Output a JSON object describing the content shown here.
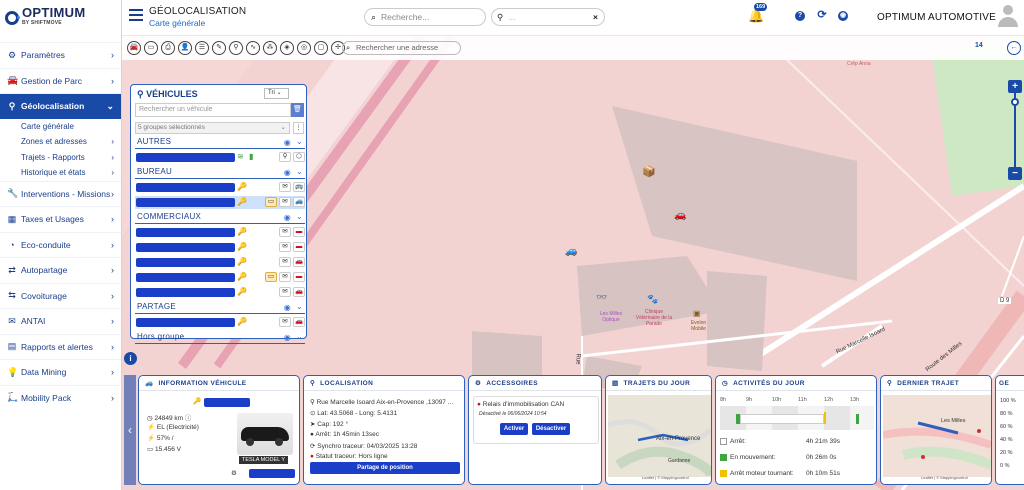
{
  "brand": {
    "name": "OPTIMUM",
    "tagline": "BY SHIFTMOVE"
  },
  "sidebar": {
    "items": [
      {
        "label": "Paramètres",
        "icon": "gear-icon"
      },
      {
        "label": "Gestion de Parc",
        "icon": "car-icon"
      },
      {
        "label": "Géolocalisation",
        "icon": "map-pin-icon",
        "active": true,
        "sub": [
          "Carte générale",
          "Zones et adresses",
          "Trajets - Rapports",
          "Historique et états"
        ]
      },
      {
        "label": "Interventions - Missions",
        "icon": "wrench-icon"
      },
      {
        "label": "Taxes et Usages",
        "icon": "money-icon"
      },
      {
        "label": "Eco-conduite",
        "icon": "eco-icon"
      },
      {
        "label": "Autopartage",
        "icon": "share-icon"
      },
      {
        "label": "Covoiturage",
        "icon": "carpool-icon"
      },
      {
        "label": "ANTAI",
        "icon": "mail-icon"
      },
      {
        "label": "Rapports et alertes",
        "icon": "report-icon"
      },
      {
        "label": "Data Mining",
        "icon": "bulb-icon"
      },
      {
        "label": "Mobility Pack",
        "icon": "scooter-icon"
      }
    ]
  },
  "header": {
    "title": "GÉOLOCALISATION",
    "subtitle": "Carte générale",
    "search_placeholder": "Recherche...",
    "location_placeholder": "...",
    "notif_count": "169",
    "company": "OPTIMUM AUTOMOTIVE"
  },
  "toolbar": {
    "address_placeholder": "Rechercher une adresse",
    "zoom_level": "14"
  },
  "map": {
    "labels": {
      "pharmacy": "Les Milles Optique",
      "clinic": "Clinique Vétérinaire de la Parade",
      "store": "Evelon Mobile",
      "street": "Rue Marcelle Isoard",
      "street2": "Rue",
      "route": "D 9",
      "road2": "Route des Milles",
      "poi_top": "Crêp Anna"
    }
  },
  "vehicles": {
    "title": "VÉHICULES",
    "sort_label": "Tri",
    "search_placeholder": "Rechercher un véhicule",
    "group_select": "5 groupes sélectionnés",
    "groups": [
      {
        "name": "AUTRES",
        "rows": 1
      },
      {
        "name": "BUREAU",
        "rows": 2
      },
      {
        "name": "COMMERCIAUX",
        "rows": 6
      },
      {
        "name": "PARTAGE",
        "rows": 1
      },
      {
        "name": "Hors groupe",
        "rows": 0
      }
    ]
  },
  "info": {
    "title": "INFORMATION VÉHICULE",
    "km": "24849 km",
    "energy": "EL (Electricité)",
    "battery": "57% /",
    "voltage": "15.456 V",
    "model": "TESLA MODEL Y"
  },
  "location": {
    "title": "LOCALISATION",
    "address": "Rue Marcelle Isoard Aix-en-Provence ,13097 ...",
    "coords": "Lat: 43.5068 - Long: 5.4131",
    "cap": "Cap: 192 °",
    "stop": "Arrêt: 1h 45min 13sec",
    "sync": "Synchro traceur: 04/03/2025 13:28",
    "status": "Statut traceur: Hors ligne",
    "share_btn": "Partage de position"
  },
  "accessories": {
    "title": "ACCESSOIRES",
    "name": "Relais d'immobilisation CAN",
    "desc": "Désactivé le 06/06/2024 10:54",
    "activate": "Activer",
    "deactivate": "Désactiver"
  },
  "trips": {
    "title": "TRAJETS DU JOUR",
    "city": "Aix-en-Provence",
    "town2": "Gardanne",
    "attribution": "Leaflet | © Mappingcontrol"
  },
  "activities": {
    "title": "ACTIVITÉS DU JOUR",
    "hours": [
      "8h",
      "9h",
      "10h",
      "11h",
      "12h",
      "13h"
    ],
    "stop_label": "Arrêt:",
    "stop_val": "4h 21m 39s",
    "move_label": "En mouvement:",
    "move_val": "0h 26m 0s",
    "idle_label": "Arrêt moteur tournant:",
    "idle_val": "0h 10m 51s"
  },
  "last_trip": {
    "title": "DERNIER TRAJET",
    "city": "Les Milles",
    "attribution": "Leaflet | © Mappingcontrol"
  },
  "extra": {
    "title": "GE",
    "values": [
      "100 %",
      "80 %",
      "60 %",
      "40 %",
      "20 %",
      "0 %"
    ]
  },
  "colors": {
    "primary": "#1a4aa8",
    "accent": "#1a3ec8",
    "map_bg": "#f5d7d6",
    "green": "#3fa53f",
    "yellow": "#f2c200"
  }
}
